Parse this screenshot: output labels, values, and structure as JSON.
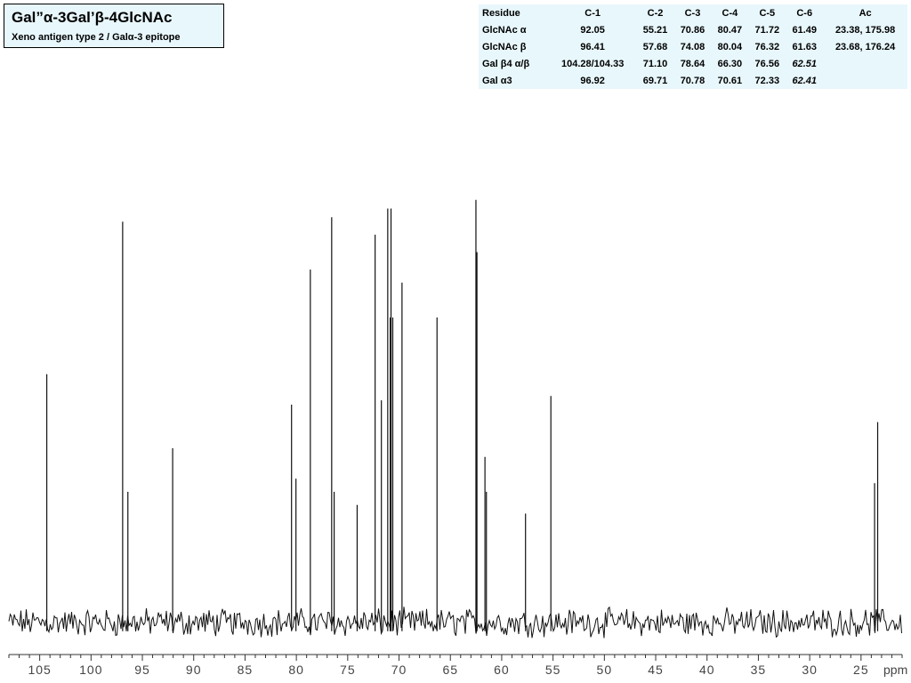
{
  "title": "Gal”α-3Gal’β-4GlcNAc",
  "subtitle": "Xeno antigen type 2 / Galα-3 epitope",
  "table": {
    "headers": [
      "Residue",
      "C-1",
      "C-2",
      "C-3",
      "C-4",
      "C-5",
      "C-6",
      "Ac"
    ],
    "rows": [
      {
        "cells": [
          "GlcNAc α",
          "92.05",
          "55.21",
          "70.86",
          "80.47",
          "71.72",
          "61.49",
          "23.38, 175.98"
        ],
        "italic": []
      },
      {
        "cells": [
          "GlcNAc β",
          "96.41",
          "57.68",
          "74.08",
          "80.04",
          "76.32",
          "61.63",
          "23.68, 176.24"
        ],
        "italic": []
      },
      {
        "cells": [
          "Gal β4 α/β",
          "104.28/104.33",
          "71.10",
          "78.64",
          "66.30",
          "76.56",
          "62.51",
          ""
        ],
        "italic": [
          6
        ]
      },
      {
        "cells": [
          "Gal α3",
          "96.92",
          "69.71",
          "70.78",
          "70.61",
          "72.33",
          "62.41",
          ""
        ],
        "italic": [
          6
        ]
      }
    ]
  },
  "chart_data": {
    "type": "line",
    "title": "",
    "xlabel": "ppm",
    "ylabel": "",
    "x_reversed": true,
    "xlim": [
      108,
      21
    ],
    "ylim": [
      -0.06,
      1.0
    ],
    "grid": false,
    "xticks": [
      105,
      100,
      95,
      90,
      85,
      80,
      75,
      70,
      65,
      60,
      55,
      50,
      45,
      40,
      35,
      30,
      25
    ],
    "noise_level": 0.025,
    "peaks": [
      {
        "x": 104.31,
        "y": 0.57
      },
      {
        "x": 96.92,
        "y": 0.92
      },
      {
        "x": 96.41,
        "y": 0.3
      },
      {
        "x": 92.05,
        "y": 0.4
      },
      {
        "x": 80.47,
        "y": 0.5
      },
      {
        "x": 80.04,
        "y": 0.33
      },
      {
        "x": 78.64,
        "y": 0.81
      },
      {
        "x": 76.56,
        "y": 0.93
      },
      {
        "x": 76.32,
        "y": 0.3
      },
      {
        "x": 74.08,
        "y": 0.27
      },
      {
        "x": 72.33,
        "y": 0.89
      },
      {
        "x": 71.72,
        "y": 0.51
      },
      {
        "x": 71.1,
        "y": 0.95
      },
      {
        "x": 70.86,
        "y": 0.7
      },
      {
        "x": 70.78,
        "y": 0.95
      },
      {
        "x": 70.61,
        "y": 0.7
      },
      {
        "x": 69.71,
        "y": 0.78
      },
      {
        "x": 66.3,
        "y": 0.7
      },
      {
        "x": 62.51,
        "y": 0.97
      },
      {
        "x": 62.41,
        "y": 0.85
      },
      {
        "x": 61.63,
        "y": 0.38
      },
      {
        "x": 61.49,
        "y": 0.3
      },
      {
        "x": 57.68,
        "y": 0.25
      },
      {
        "x": 55.21,
        "y": 0.52
      },
      {
        "x": 23.68,
        "y": 0.32
      },
      {
        "x": 23.38,
        "y": 0.46
      }
    ]
  }
}
